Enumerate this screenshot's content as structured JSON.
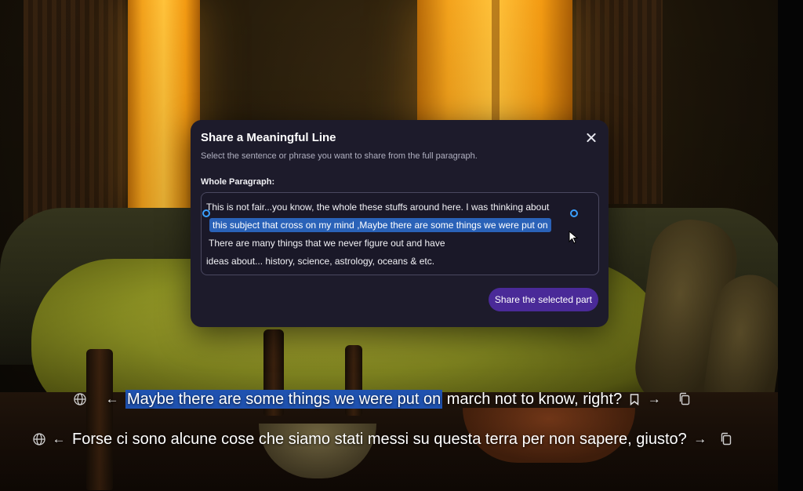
{
  "modal": {
    "title": "Share a Meaningful Line",
    "subtitle": "Select the sentence or phrase you want to share from the full paragraph.",
    "paragraph_label": "Whole Paragraph:",
    "paragraph_lines": [
      "This is not fair...you know, the whole these stuffs around here.  I was thinking about",
      "this subject that cross on my mind ,Maybe there are some things we were put on",
      "There are many things that we never figure out and have",
      "ideas about... history, science, astrology, oceans & etc."
    ],
    "share_button_label": "Share the selected part",
    "close_icon": "close-icon"
  },
  "subtitles": {
    "primary": {
      "selected_text": "Maybe there are some things we were put on",
      "rest_text": " march not to know, right?",
      "icons": [
        "globe-icon",
        "arrow-left-icon",
        "bookmark-icon",
        "arrow-right-icon",
        "copy-icon"
      ]
    },
    "translation": {
      "text": "Forse ci sono alcune cose che siamo stati messi su questa terra per non sapere, giusto?",
      "icons": [
        "globe-icon",
        "arrow-left-icon",
        "arrow-right-icon",
        "copy-icon"
      ]
    }
  },
  "colors": {
    "modal_bg": "#1d1b2b",
    "selection": "#2a62b8",
    "share_button": "#4a2a98",
    "subtitle_selection": "#1f52b0"
  }
}
